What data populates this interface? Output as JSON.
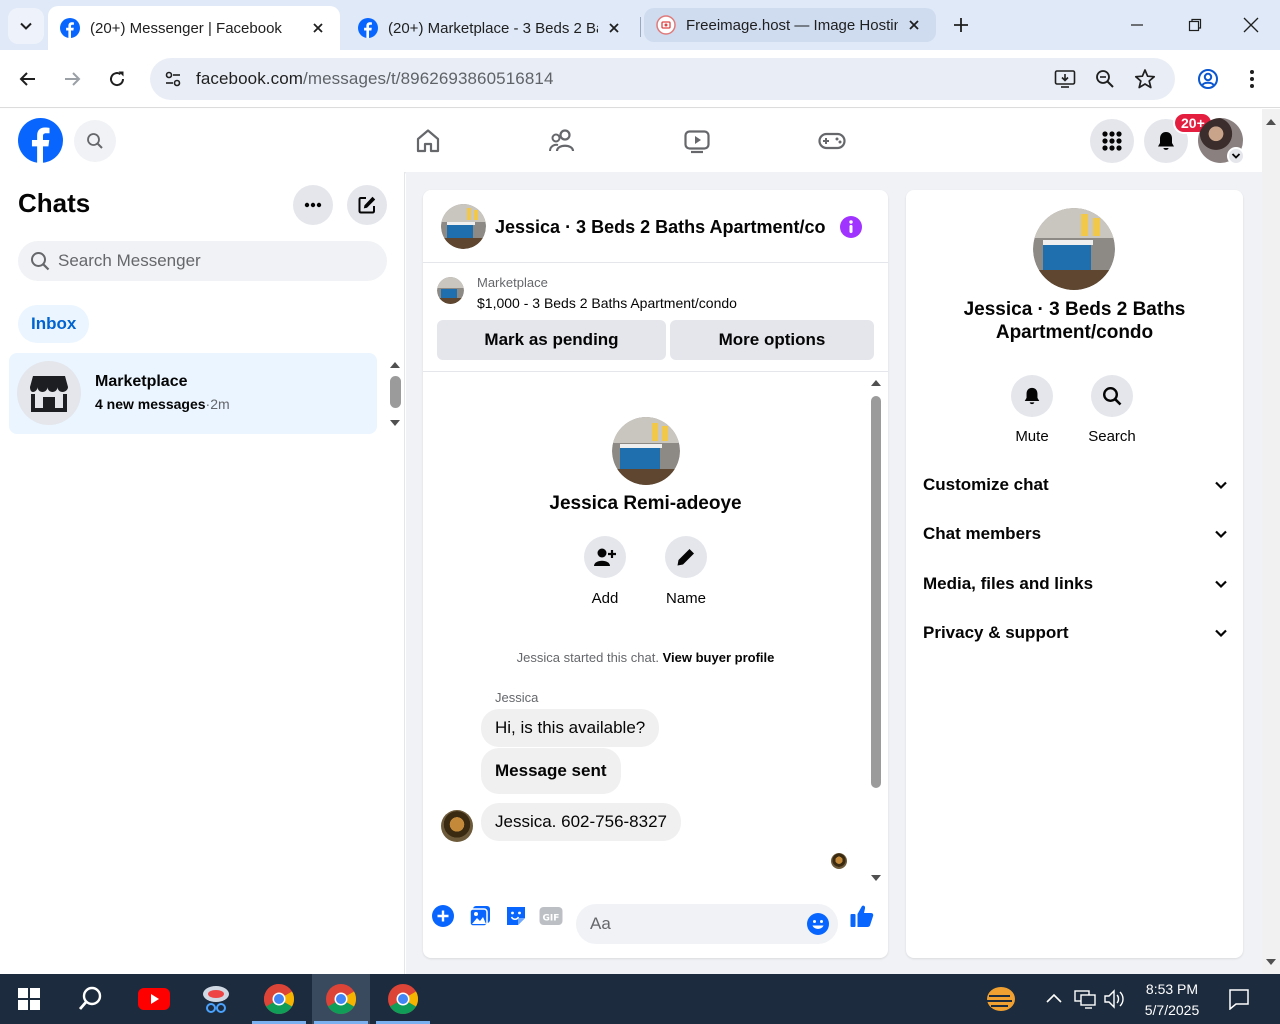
{
  "browser": {
    "tabs": [
      {
        "title": "(20+) Messenger | Facebook",
        "icon": "facebook-icon",
        "active": true
      },
      {
        "title": "(20+) Marketplace - 3 Beds 2 Ba",
        "icon": "facebook-icon",
        "active": false
      },
      {
        "title": "Freeimage.host — Image Hostin",
        "icon": "freeimage-icon",
        "active": false
      }
    ],
    "url_host": "facebook.com",
    "url_path": "/messages/t/8962693860516814"
  },
  "fb_header": {
    "notification_badge": "20+"
  },
  "chats": {
    "title": "Chats",
    "search_placeholder": "Search Messenger",
    "filter_label": "Inbox",
    "items": [
      {
        "name": "Marketplace",
        "new_messages": "4 new messages",
        "separator": "·",
        "time": "2m",
        "icon": "storefront-icon"
      }
    ]
  },
  "conversation": {
    "title": "Jessica · 3 Beds 2 Baths Apartment/condo",
    "listing_source": "Marketplace",
    "listing_title": "$1,000 - 3 Beds 2 Baths Apartment/condo",
    "mark_pending_label": "Mark as pending",
    "more_options_label": "More options",
    "profile_name": "Jessica Remi-adeoye",
    "actions": [
      {
        "label": "Add",
        "icon": "add-person-icon"
      },
      {
        "label": "Name",
        "icon": "pencil-icon"
      }
    ],
    "started_text": "Jessica started this chat.",
    "view_profile_link": "View buyer profile",
    "sender_name": "Jessica",
    "messages": [
      {
        "text": "Hi, is this available?"
      },
      {
        "text": "Message sent"
      },
      {
        "text": "Jessica. 602-756-8327"
      }
    ],
    "composer_placeholder": "Aa"
  },
  "info_panel": {
    "title": "Jessica · 3 Beds 2 Baths Apartment/condo",
    "actions": [
      {
        "label": "Mute",
        "icon": "bell-icon"
      },
      {
        "label": "Search",
        "icon": "search-icon"
      }
    ],
    "sections": [
      {
        "label": "Customize chat"
      },
      {
        "label": "Chat members"
      },
      {
        "label": "Media, files and links"
      },
      {
        "label": "Privacy & support"
      }
    ]
  },
  "taskbar": {
    "time": "8:53 PM",
    "date": "5/7/2025"
  },
  "colors": {
    "facebook_blue": "#0866ff",
    "messenger_purple": "#a033ff",
    "badge_red": "#e41e3f"
  }
}
